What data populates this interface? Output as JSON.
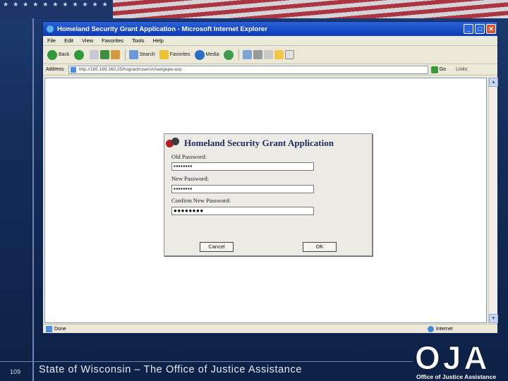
{
  "slide": {
    "number": "109",
    "footer": "State of Wisconsin – The Office of Justice Assistance",
    "logo": {
      "letters": "OJA",
      "subtitle": "Office of Justice Assistance"
    }
  },
  "browser": {
    "window_title": "Homeland Security Grant Application - Microsoft Internet Explorer",
    "menu": [
      "File",
      "Edit",
      "View",
      "Favorites",
      "Tools",
      "Help"
    ],
    "toolbar": {
      "back": "Back",
      "search": "Search",
      "favorites": "Favorites",
      "media": "Media"
    },
    "address": {
      "label": "Address",
      "url": "http://165.189.160.25/hsgrant/users/changepw.asp",
      "go": "Go",
      "links": "Links"
    },
    "status": {
      "text": "Done",
      "zone": "Internet"
    }
  },
  "dialog": {
    "title": "Homeland Security Grant Application",
    "fields": [
      {
        "label": "Old Password:",
        "value": "▪▪▪▪▪▪▪▪"
      },
      {
        "label": "New Password:",
        "value": "▪▪▪▪▪▪▪▪"
      },
      {
        "label": "Confirm New Password:",
        "value": "●●●●●●●●"
      }
    ],
    "cancel_label": "Cancel",
    "ok_label": "OK"
  }
}
